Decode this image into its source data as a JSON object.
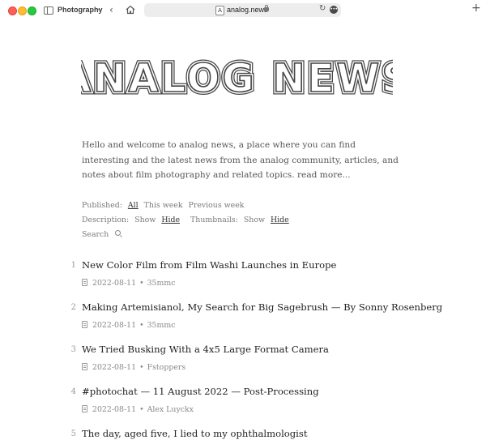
{
  "browser": {
    "tab_group": "Photography",
    "url": "analog.news",
    "site_icon_letter": "A"
  },
  "site": {
    "logo_text": "ANALOG NEWS",
    "intro": "Hello and welcome to analog news, a place where you can find interesting and the latest news from the analog community, articles, and notes about film photography and related topics.",
    "read_more": "read more..."
  },
  "filters": {
    "published_label": "Published:",
    "published_options": [
      "All",
      "This week",
      "Previous week"
    ],
    "published_selected": "All",
    "description_label": "Description:",
    "description_options": [
      "Show",
      "Hide"
    ],
    "description_selected": "Hide",
    "thumbnails_label": "Thumbnails:",
    "thumbnails_options": [
      "Show",
      "Hide"
    ],
    "thumbnails_selected": "Hide",
    "search_label": "Search"
  },
  "articles": [
    {
      "num": "1",
      "title": "New Color Film from Film Washi Launches in Europe",
      "date": "2022-08-11",
      "source": "35mmc"
    },
    {
      "num": "2",
      "title": "Making Artemisianol, My Search for Big Sagebrush — By Sonny Rosenberg",
      "date": "2022-08-11",
      "source": "35mmc"
    },
    {
      "num": "3",
      "title": "We Tried Busking With a 4x5 Large Format Camera",
      "date": "2022-08-11",
      "source": "Fstoppers"
    },
    {
      "num": "4",
      "title": "#photochat — 11 August 2022 — Post-Processing",
      "date": "2022-08-11",
      "source": "Alex Luyckx"
    },
    {
      "num": "5",
      "title": "The day, aged five, I lied to my ophthalmologist",
      "date": "",
      "source": ""
    }
  ],
  "meta_separator": "•",
  "colors": {
    "text": "#2b2b2b",
    "muted": "#7a7a7a",
    "urlbar": "#ededed"
  }
}
